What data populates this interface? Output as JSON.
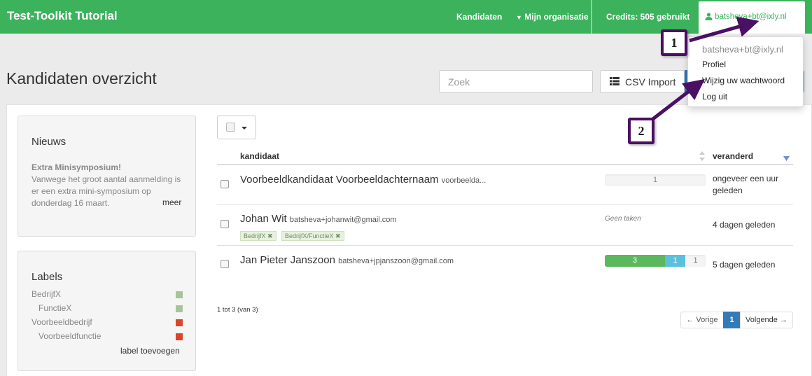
{
  "navbar": {
    "brand": "Test-Toolkit Tutorial",
    "kandidaten": "Kandidaten",
    "organisatie": "Mijn organisatie",
    "credits": "Credits: 505 gebruikt",
    "user": "batsheva+bt@ixly.nl",
    "bg_color": "#3cb25c"
  },
  "dropdown": {
    "email": "batsheva+bt@ixly.nl",
    "profiel": "Profiel",
    "wijzig": "Wijzig uw wachtwoord",
    "logout": "Log uit"
  },
  "page": {
    "title": "Kandidaten overzicht",
    "search_placeholder": "Zoek",
    "csv_import": "CSV Import"
  },
  "news": {
    "title": "Nieuws",
    "headline": "Extra Minisymposium!",
    "body": "Vanwege het groot aantal aanmelding is er een extra mini-symposium op donderdag 16 maart.",
    "more": "meer"
  },
  "labels": {
    "title": "Labels",
    "items": [
      {
        "name": "BedrijfX",
        "color": "#a8c39a"
      },
      {
        "name": "FunctieX",
        "color": "#a8c39a"
      },
      {
        "name": "Voorbeeldbedrijf",
        "color": "#d9452a"
      },
      {
        "name": "Voorbeeldfunctie",
        "color": "#d9452a"
      }
    ],
    "add": "label toevoegen"
  },
  "table": {
    "col_kandidaat": "kandidaat",
    "col_veranderd": "veranderd",
    "rows": [
      {
        "name": "Voorbeeldkandidaat Voorbeeldachternaam",
        "email": "voorbeelda...",
        "progress": {
          "pending": "1"
        },
        "changed": "ongeveer een uur geleden"
      },
      {
        "name": "Johan Wit",
        "email": "batsheva+johanwit@gmail.com",
        "tags": [
          "BedrijfX ✖",
          "BedrijfX/FunctieX ✖"
        ],
        "tasks_note": "Geen taken",
        "changed": "4 dagen geleden"
      },
      {
        "name": "Jan Pieter Janszoon",
        "email": "batsheva+jpjanszoon@gmail.com",
        "progress": {
          "done": "3",
          "active": "1",
          "pending": "1"
        },
        "changed": "5 dagen geleden"
      }
    ],
    "count": "1 tot 3 (van 3)"
  },
  "pagination": {
    "prev": "← Vorige",
    "current": "1",
    "next": "Volgende →"
  },
  "annotations": {
    "callout_1": "1",
    "callout_2": "2",
    "color": "#4b0f63"
  }
}
